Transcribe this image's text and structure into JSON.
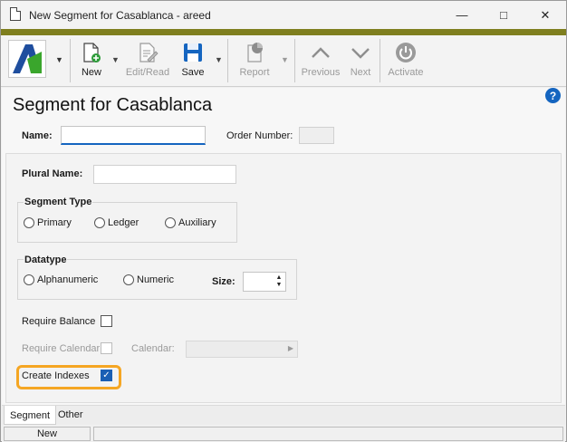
{
  "window": {
    "title": "New Segment for Casablanca - areed"
  },
  "toolbar": {
    "new_label": "New",
    "edit_read_label": "Edit/Read",
    "save_label": "Save",
    "report_label": "Report",
    "previous_label": "Previous",
    "next_label": "Next",
    "activate_label": "Activate"
  },
  "page": {
    "title": "Segment for Casablanca"
  },
  "form": {
    "name_label": "Name:",
    "name_value": "",
    "order_number_label": "Order Number:",
    "order_number_value": "",
    "plural_name_label": "Plural Name:",
    "plural_name_value": "",
    "segment_type": {
      "legend": "Segment Type",
      "options": [
        "Primary",
        "Ledger",
        "Auxiliary"
      ]
    },
    "datatype": {
      "legend": "Datatype",
      "options": [
        "Alphanumeric",
        "Numeric"
      ],
      "size_label": "Size:",
      "size_value": ""
    },
    "require_balance_label": "Require Balance",
    "require_balance_checked": false,
    "require_calendar_label": "Require Calendar",
    "require_calendar_checked": false,
    "calendar_label": "Calendar:",
    "calendar_value": "",
    "create_indexes_label": "Create Indexes",
    "create_indexes_checked": true
  },
  "tabs": [
    "Segment",
    "Other"
  ],
  "status": {
    "mode": "New"
  },
  "colors": {
    "accent": "#1565c0",
    "highlight": "#f5a623",
    "title_strip": "#7f7f1f",
    "checkbox_checked": "#1a5fb4"
  }
}
